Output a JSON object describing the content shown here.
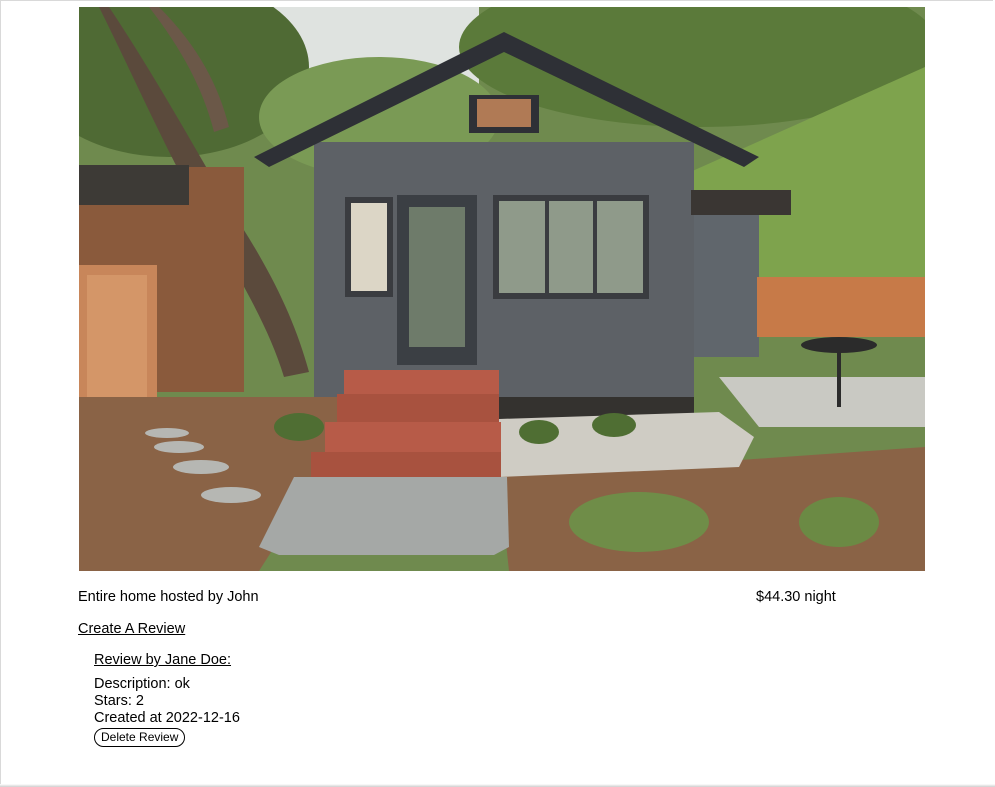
{
  "listing": {
    "host_text": "Entire home hosted by John",
    "price_text": "$44.30 night",
    "create_review_label": "Create A Review"
  },
  "review": {
    "title": "Review by Jane Doe:",
    "description": "Description: ok",
    "stars": "Stars: 2",
    "created": "Created at 2022-12-16",
    "delete_label": "Delete Review"
  }
}
